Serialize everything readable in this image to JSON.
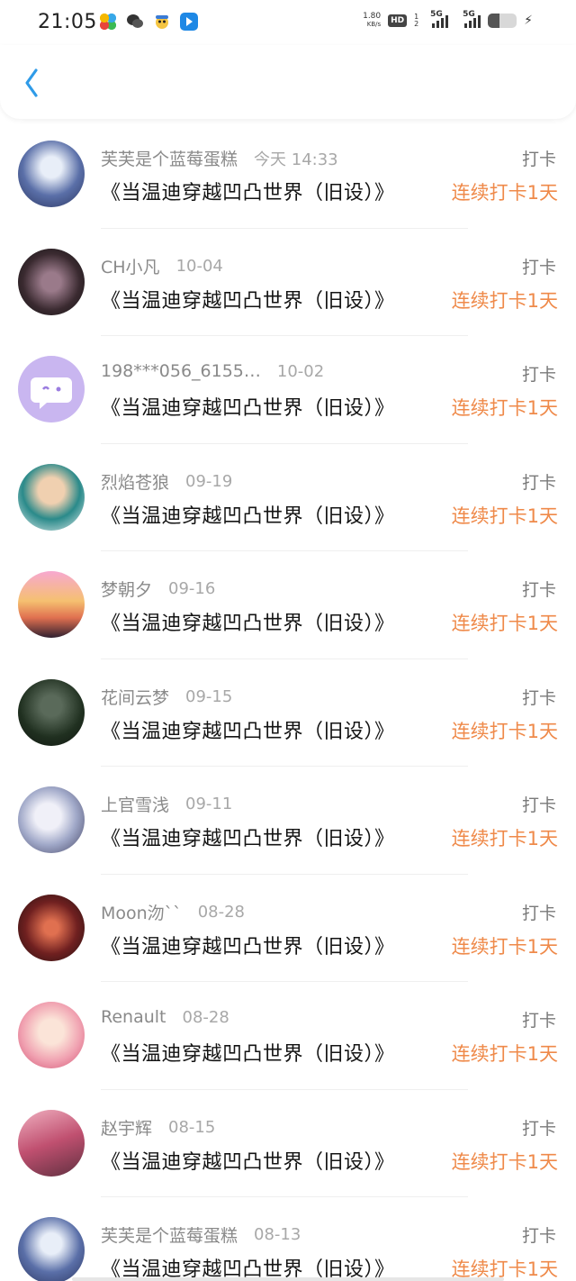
{
  "status_bar": {
    "time": "21:05",
    "netspeed_value": "1.80",
    "netspeed_unit": "KB/s",
    "hd_label": "HD",
    "hd_sub": "1 2",
    "sig1_label": "5G",
    "sig2_label": "5G"
  },
  "header": {
    "back_icon": "chevron-left-icon",
    "accent_color": "#2f9be8"
  },
  "colors": {
    "streak": "#ef8a4a",
    "name": "#8a8a8a"
  },
  "entries": [
    {
      "name": "芙芙是个蓝莓蛋糕",
      "date": "今天 14:33",
      "title": "《当温迪穿越凹凸世界（旧设）》",
      "action": "打卡",
      "streak": "连续打卡1天"
    },
    {
      "name": "CH小凡",
      "date": "10-04",
      "title": "《当温迪穿越凹凸世界（旧设）》",
      "action": "打卡",
      "streak": "连续打卡1天"
    },
    {
      "name": "198***056_6155…",
      "date": "10-02",
      "title": "《当温迪穿越凹凸世界（旧设）》",
      "action": "打卡",
      "streak": "连续打卡1天"
    },
    {
      "name": "烈焰苍狼",
      "date": "09-19",
      "title": "《当温迪穿越凹凸世界（旧设）》",
      "action": "打卡",
      "streak": "连续打卡1天"
    },
    {
      "name": "梦朝夕",
      "date": "09-16",
      "title": "《当温迪穿越凹凸世界（旧设）》",
      "action": "打卡",
      "streak": "连续打卡1天"
    },
    {
      "name": "花间云梦",
      "date": "09-15",
      "title": "《当温迪穿越凹凸世界（旧设）》",
      "action": "打卡",
      "streak": "连续打卡1天"
    },
    {
      "name": "上官雪浅",
      "date": "09-11",
      "title": "《当温迪穿越凹凸世界（旧设）》",
      "action": "打卡",
      "streak": "连续打卡1天"
    },
    {
      "name": "Moon沕``",
      "date": "08-28",
      "title": "《当温迪穿越凹凸世界（旧设）》",
      "action": "打卡",
      "streak": "连续打卡1天"
    },
    {
      "name": "Renault",
      "date": "08-28",
      "title": "《当温迪穿越凹凸世界（旧设）》",
      "action": "打卡",
      "streak": "连续打卡1天"
    },
    {
      "name": "赵宇辉",
      "date": "08-15",
      "title": "《当温迪穿越凹凸世界（旧设）》",
      "action": "打卡",
      "streak": "连续打卡1天"
    },
    {
      "name": "芙芙是个蓝莓蛋糕",
      "date": "08-13",
      "title": "《当温迪穿越凹凸世界（旧设）》",
      "action": "打卡",
      "streak": "连续打卡1天"
    }
  ]
}
